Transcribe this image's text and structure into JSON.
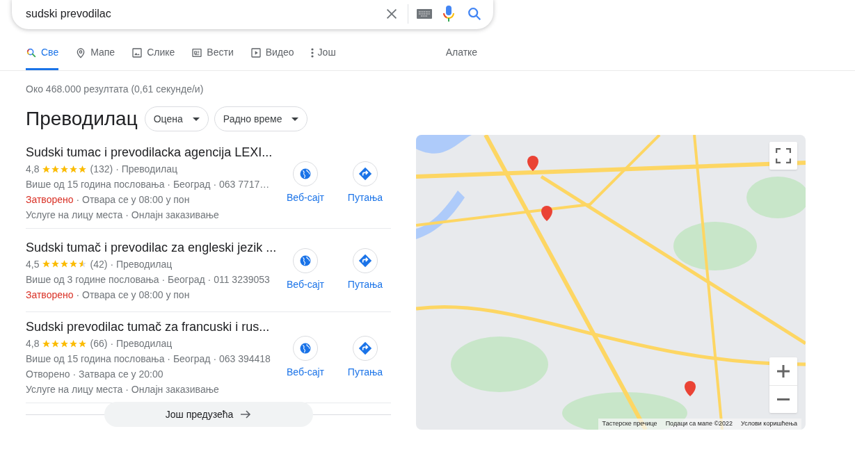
{
  "search": {
    "value": "sudski prevodilac"
  },
  "tabs": [
    {
      "label": "Све",
      "selected": true
    },
    {
      "label": "Мапе",
      "selected": false
    },
    {
      "label": "Слике",
      "selected": false
    },
    {
      "label": "Вести",
      "selected": false
    },
    {
      "label": "Видео",
      "selected": false
    },
    {
      "label": "Још",
      "selected": false
    }
  ],
  "tools": "Алатке",
  "result_stats": "Око 468.000 резултата (0,61 секунде/и)",
  "local_pack": {
    "heading": "Преводилац",
    "filters": [
      "Оцена",
      "Радно време"
    ],
    "places": [
      {
        "title": "Sudski tumac i prevodilacka agencija LEXI...",
        "rating": "4,8",
        "stars": 5,
        "reviews": "(132)",
        "category": "· Преводилац",
        "details": "Више од 15 година пословања · Београд · 063 7717…",
        "status": {
          "label": "Затворено",
          "open": false,
          "text": "· Отвара се у 08:00 у пон"
        },
        "services": "Услуге на лицу места · Онлајн заказивање",
        "website": "Веб-сајт",
        "directions": "Путања"
      },
      {
        "title": "Sudski tumač i prevodilac za engleski jezik ...",
        "rating": "4,5",
        "stars": 4.5,
        "reviews": "(42)",
        "category": "· Преводилац",
        "details": "Више од 3 године пословања · Београд · 011 3239053",
        "status": {
          "label": "Затворено",
          "open": false,
          "text": "· Отвара се у 08:00 у пон"
        },
        "website": "Веб-сајт",
        "directions": "Путања"
      },
      {
        "title": "Sudski prevodilac tumač za francuski i rus...",
        "rating": "4,8",
        "stars": 5,
        "reviews": "(66)",
        "category": "· Преводилац",
        "details": "Више од 15 година пословања · Београд · 063 394418",
        "status": {
          "label": "Отворено",
          "open": true,
          "text": "· Затвара се у 20:00"
        },
        "services": "Услуге на лицу места · Онлајн заказивање",
        "website": "Веб-сајт",
        "directions": "Путања"
      }
    ],
    "more_button": "Још предузећа"
  },
  "map": {
    "kind": "picture",
    "attribution": [
      "Тастерске пречице",
      "Подаци са мапе ©2022",
      "Услови коришћења"
    ]
  }
}
